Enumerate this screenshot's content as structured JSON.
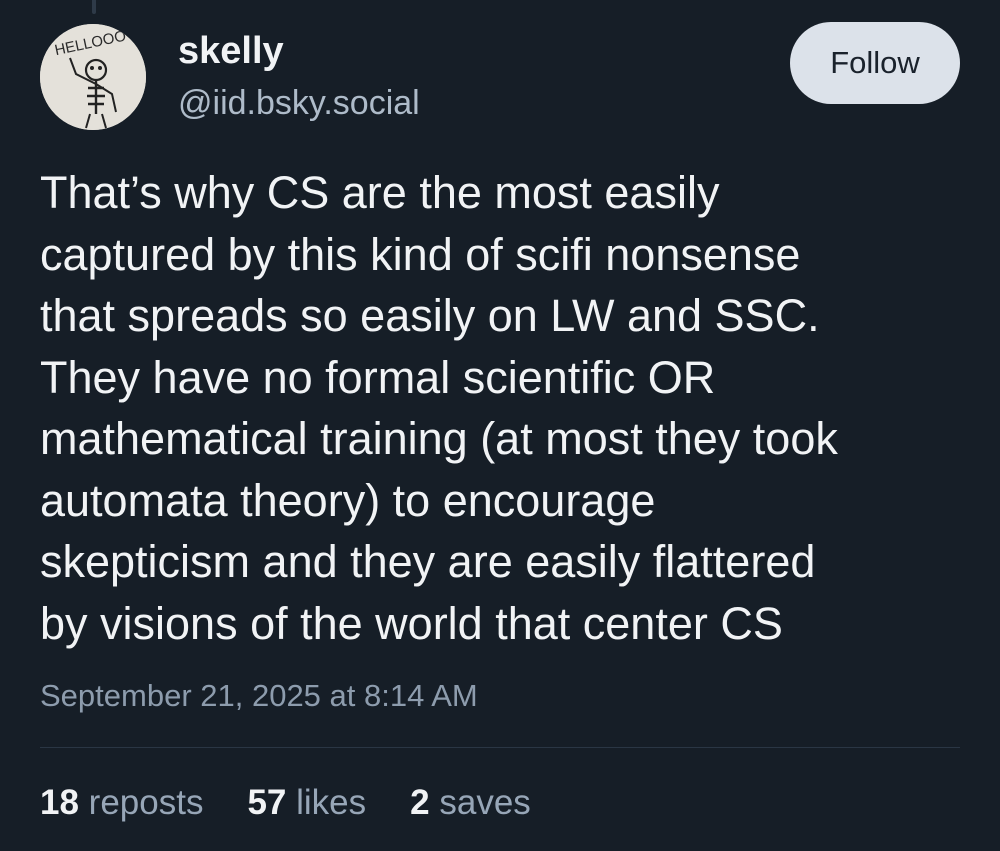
{
  "post": {
    "author": {
      "display_name": "skelly",
      "handle": "@iid.bsky.social",
      "avatar_text": "HELLOOO"
    },
    "follow_label": "Follow",
    "text": "That’s why CS are the most easily\ncaptured by this kind of scifi nonsense\nthat spreads so easily on LW and SSC.\nThey have no formal scientific OR\nmathematical training (at most they took\nautomata theory) to encourage\nskepticism and they are easily flattered\nby visions of the world that center CS",
    "timestamp": "September 21, 2025 at 8:14 AM",
    "stats": {
      "reposts_count": "18",
      "reposts_label": "reposts",
      "likes_count": "57",
      "likes_label": "likes",
      "saves_count": "2",
      "saves_label": "saves"
    }
  },
  "colors": {
    "background": "#161e27",
    "text_primary": "#f1f3f5",
    "text_secondary": "#aebbc9",
    "follow_button_bg": "#dce2ea"
  }
}
